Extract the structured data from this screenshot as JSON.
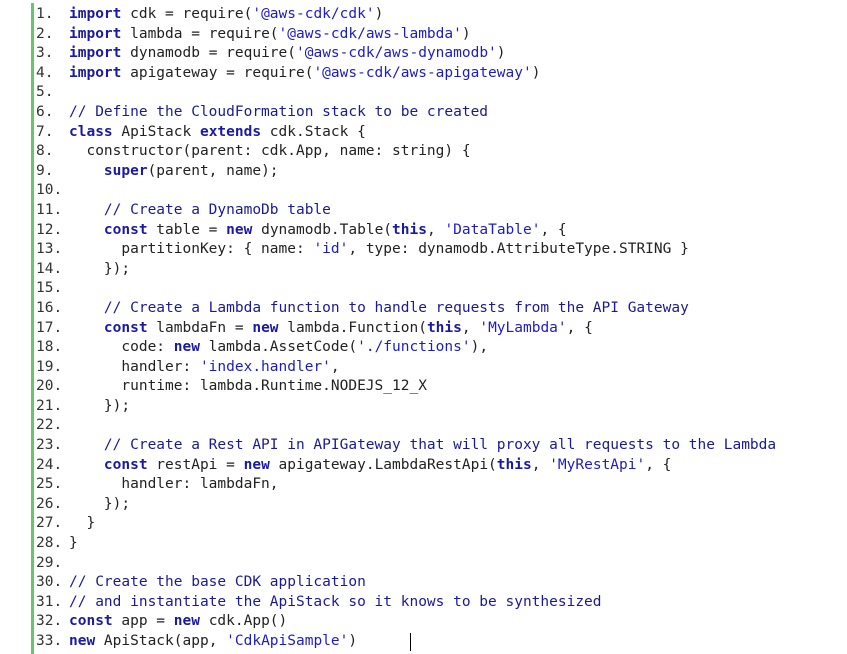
{
  "editor": {
    "lines": [
      {
        "num": "1.",
        "tokens": [
          {
            "t": "import",
            "c": "kw"
          },
          {
            "t": " cdk = require(",
            "c": "id"
          },
          {
            "t": "'@aws-cdk/cdk'",
            "c": "str"
          },
          {
            "t": ")",
            "c": "id"
          }
        ]
      },
      {
        "num": "2.",
        "tokens": [
          {
            "t": "import",
            "c": "kw"
          },
          {
            "t": " lambda = require(",
            "c": "id"
          },
          {
            "t": "'@aws-cdk/aws-lambda'",
            "c": "str"
          },
          {
            "t": ")",
            "c": "id"
          }
        ]
      },
      {
        "num": "3.",
        "tokens": [
          {
            "t": "import",
            "c": "kw"
          },
          {
            "t": " dynamodb = require(",
            "c": "id"
          },
          {
            "t": "'@aws-cdk/aws-dynamodb'",
            "c": "str"
          },
          {
            "t": ")",
            "c": "id"
          }
        ]
      },
      {
        "num": "4.",
        "tokens": [
          {
            "t": "import",
            "c": "kw"
          },
          {
            "t": " apigateway = require(",
            "c": "id"
          },
          {
            "t": "'@aws-cdk/aws-apigateway'",
            "c": "str"
          },
          {
            "t": ")",
            "c": "id"
          }
        ]
      },
      {
        "num": "5.",
        "tokens": []
      },
      {
        "num": "6.",
        "tokens": [
          {
            "t": "// Define the CloudFormation stack to be created",
            "c": "cm"
          }
        ]
      },
      {
        "num": "7.",
        "tokens": [
          {
            "t": "class",
            "c": "kw"
          },
          {
            "t": " ApiStack ",
            "c": "id"
          },
          {
            "t": "extends",
            "c": "kw"
          },
          {
            "t": " cdk.Stack {",
            "c": "id"
          }
        ]
      },
      {
        "num": "8.",
        "tokens": [
          {
            "t": "  constructor(parent: cdk.App, name: string) {",
            "c": "id"
          }
        ]
      },
      {
        "num": "9.",
        "tokens": [
          {
            "t": "    ",
            "c": "id"
          },
          {
            "t": "super",
            "c": "kw"
          },
          {
            "t": "(parent, name);",
            "c": "id"
          }
        ]
      },
      {
        "num": "10.",
        "tokens": []
      },
      {
        "num": "11.",
        "tokens": [
          {
            "t": "    // Create a DynamoDb table",
            "c": "cm"
          }
        ]
      },
      {
        "num": "12.",
        "tokens": [
          {
            "t": "    ",
            "c": "id"
          },
          {
            "t": "const",
            "c": "kw"
          },
          {
            "t": " table = ",
            "c": "id"
          },
          {
            "t": "new",
            "c": "kw"
          },
          {
            "t": " dynamodb.Table(",
            "c": "id"
          },
          {
            "t": "this",
            "c": "kw"
          },
          {
            "t": ", ",
            "c": "id"
          },
          {
            "t": "'DataTable'",
            "c": "str"
          },
          {
            "t": ", {",
            "c": "id"
          }
        ]
      },
      {
        "num": "13.",
        "tokens": [
          {
            "t": "      partitionKey: { name: ",
            "c": "id"
          },
          {
            "t": "'id'",
            "c": "str"
          },
          {
            "t": ", type: dynamodb.AttributeType.STRING }",
            "c": "id"
          }
        ]
      },
      {
        "num": "14.",
        "tokens": [
          {
            "t": "    });",
            "c": "id"
          }
        ]
      },
      {
        "num": "15.",
        "tokens": []
      },
      {
        "num": "16.",
        "tokens": [
          {
            "t": "    // Create a Lambda function to handle requests from the API Gateway",
            "c": "cm"
          }
        ]
      },
      {
        "num": "17.",
        "tokens": [
          {
            "t": "    ",
            "c": "id"
          },
          {
            "t": "const",
            "c": "kw"
          },
          {
            "t": " lambdaFn = ",
            "c": "id"
          },
          {
            "t": "new",
            "c": "kw"
          },
          {
            "t": " lambda.Function(",
            "c": "id"
          },
          {
            "t": "this",
            "c": "kw"
          },
          {
            "t": ", ",
            "c": "id"
          },
          {
            "t": "'MyLambda'",
            "c": "str"
          },
          {
            "t": ", {",
            "c": "id"
          }
        ]
      },
      {
        "num": "18.",
        "tokens": [
          {
            "t": "      code: ",
            "c": "id"
          },
          {
            "t": "new",
            "c": "kw"
          },
          {
            "t": " lambda.AssetCode(",
            "c": "id"
          },
          {
            "t": "'./functions'",
            "c": "str"
          },
          {
            "t": "),",
            "c": "id"
          }
        ]
      },
      {
        "num": "19.",
        "tokens": [
          {
            "t": "      handler: ",
            "c": "id"
          },
          {
            "t": "'index.handler'",
            "c": "str"
          },
          {
            "t": ",",
            "c": "id"
          }
        ]
      },
      {
        "num": "20.",
        "tokens": [
          {
            "t": "      runtime: lambda.Runtime.NODEJS_12_X",
            "c": "id"
          }
        ]
      },
      {
        "num": "21.",
        "tokens": [
          {
            "t": "    });",
            "c": "id"
          }
        ]
      },
      {
        "num": "22.",
        "tokens": []
      },
      {
        "num": "23.",
        "tokens": [
          {
            "t": "    // Create a Rest API in APIGateway that will proxy all requests to the Lambda",
            "c": "cm"
          }
        ]
      },
      {
        "num": "24.",
        "tokens": [
          {
            "t": "    ",
            "c": "id"
          },
          {
            "t": "const",
            "c": "kw"
          },
          {
            "t": " restApi = ",
            "c": "id"
          },
          {
            "t": "new",
            "c": "kw"
          },
          {
            "t": " apigateway.LambdaRestApi(",
            "c": "id"
          },
          {
            "t": "this",
            "c": "kw"
          },
          {
            "t": ", ",
            "c": "id"
          },
          {
            "t": "'MyRestApi'",
            "c": "str"
          },
          {
            "t": ", {",
            "c": "id"
          }
        ]
      },
      {
        "num": "25.",
        "tokens": [
          {
            "t": "      handler: lambdaFn,",
            "c": "id"
          }
        ]
      },
      {
        "num": "26.",
        "tokens": [
          {
            "t": "    });",
            "c": "id"
          }
        ]
      },
      {
        "num": "27.",
        "tokens": [
          {
            "t": "  }",
            "c": "id"
          }
        ]
      },
      {
        "num": "28.",
        "tokens": [
          {
            "t": "}",
            "c": "id"
          }
        ]
      },
      {
        "num": "29.",
        "tokens": []
      },
      {
        "num": "30.",
        "tokens": [
          {
            "t": "// Create the base CDK application",
            "c": "cm"
          }
        ]
      },
      {
        "num": "31.",
        "tokens": [
          {
            "t": "// and instantiate the ApiStack so it knows to be synthesized",
            "c": "cm"
          }
        ]
      },
      {
        "num": "32.",
        "tokens": [
          {
            "t": "const",
            "c": "kw"
          },
          {
            "t": " app = ",
            "c": "id"
          },
          {
            "t": "new",
            "c": "kw"
          },
          {
            "t": " cdk.App()",
            "c": "id"
          }
        ]
      },
      {
        "num": "33.",
        "tokens": [
          {
            "t": "new",
            "c": "kw"
          },
          {
            "t": " ApiStack(app, ",
            "c": "id"
          },
          {
            "t": "'CdkApiSample'",
            "c": "str"
          },
          {
            "t": ")",
            "c": "id"
          }
        ]
      }
    ]
  }
}
